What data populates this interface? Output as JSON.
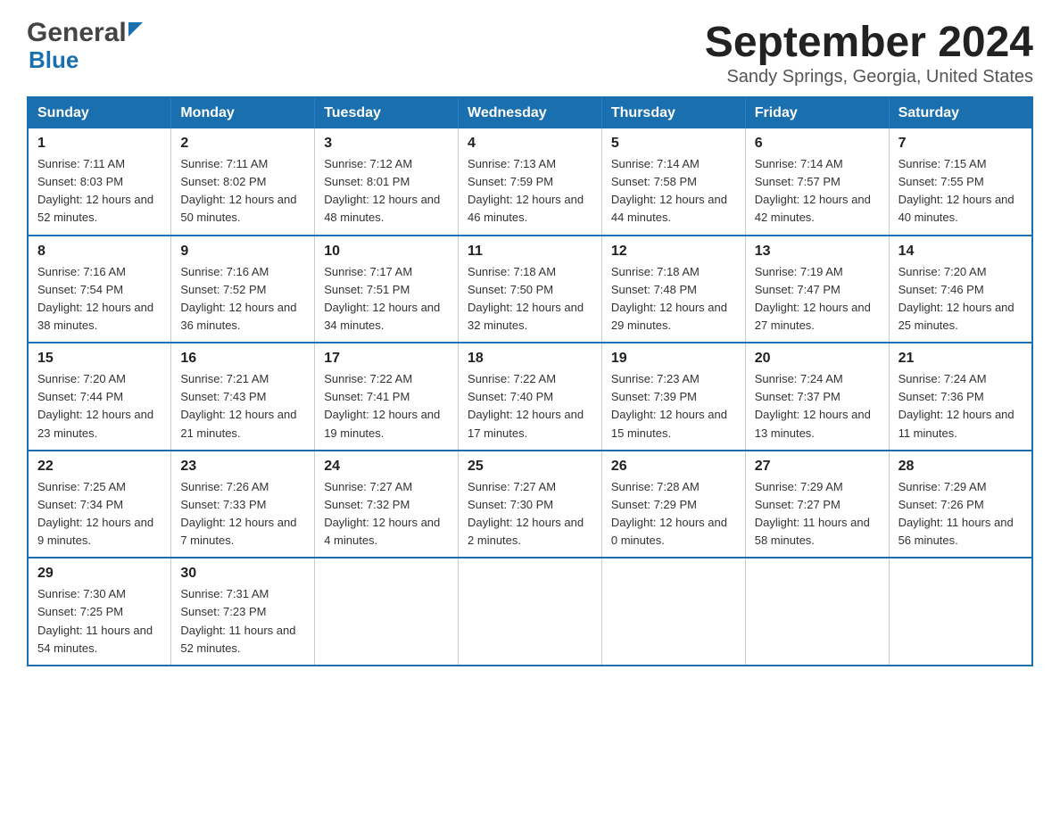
{
  "header": {
    "month_year": "September 2024",
    "location": "Sandy Springs, Georgia, United States",
    "logo_general": "General",
    "logo_blue": "Blue"
  },
  "days_of_week": [
    "Sunday",
    "Monday",
    "Tuesday",
    "Wednesday",
    "Thursday",
    "Friday",
    "Saturday"
  ],
  "weeks": [
    [
      {
        "day": "1",
        "sunrise": "Sunrise: 7:11 AM",
        "sunset": "Sunset: 8:03 PM",
        "daylight": "Daylight: 12 hours and 52 minutes."
      },
      {
        "day": "2",
        "sunrise": "Sunrise: 7:11 AM",
        "sunset": "Sunset: 8:02 PM",
        "daylight": "Daylight: 12 hours and 50 minutes."
      },
      {
        "day": "3",
        "sunrise": "Sunrise: 7:12 AM",
        "sunset": "Sunset: 8:01 PM",
        "daylight": "Daylight: 12 hours and 48 minutes."
      },
      {
        "day": "4",
        "sunrise": "Sunrise: 7:13 AM",
        "sunset": "Sunset: 7:59 PM",
        "daylight": "Daylight: 12 hours and 46 minutes."
      },
      {
        "day": "5",
        "sunrise": "Sunrise: 7:14 AM",
        "sunset": "Sunset: 7:58 PM",
        "daylight": "Daylight: 12 hours and 44 minutes."
      },
      {
        "day": "6",
        "sunrise": "Sunrise: 7:14 AM",
        "sunset": "Sunset: 7:57 PM",
        "daylight": "Daylight: 12 hours and 42 minutes."
      },
      {
        "day": "7",
        "sunrise": "Sunrise: 7:15 AM",
        "sunset": "Sunset: 7:55 PM",
        "daylight": "Daylight: 12 hours and 40 minutes."
      }
    ],
    [
      {
        "day": "8",
        "sunrise": "Sunrise: 7:16 AM",
        "sunset": "Sunset: 7:54 PM",
        "daylight": "Daylight: 12 hours and 38 minutes."
      },
      {
        "day": "9",
        "sunrise": "Sunrise: 7:16 AM",
        "sunset": "Sunset: 7:52 PM",
        "daylight": "Daylight: 12 hours and 36 minutes."
      },
      {
        "day": "10",
        "sunrise": "Sunrise: 7:17 AM",
        "sunset": "Sunset: 7:51 PM",
        "daylight": "Daylight: 12 hours and 34 minutes."
      },
      {
        "day": "11",
        "sunrise": "Sunrise: 7:18 AM",
        "sunset": "Sunset: 7:50 PM",
        "daylight": "Daylight: 12 hours and 32 minutes."
      },
      {
        "day": "12",
        "sunrise": "Sunrise: 7:18 AM",
        "sunset": "Sunset: 7:48 PM",
        "daylight": "Daylight: 12 hours and 29 minutes."
      },
      {
        "day": "13",
        "sunrise": "Sunrise: 7:19 AM",
        "sunset": "Sunset: 7:47 PM",
        "daylight": "Daylight: 12 hours and 27 minutes."
      },
      {
        "day": "14",
        "sunrise": "Sunrise: 7:20 AM",
        "sunset": "Sunset: 7:46 PM",
        "daylight": "Daylight: 12 hours and 25 minutes."
      }
    ],
    [
      {
        "day": "15",
        "sunrise": "Sunrise: 7:20 AM",
        "sunset": "Sunset: 7:44 PM",
        "daylight": "Daylight: 12 hours and 23 minutes."
      },
      {
        "day": "16",
        "sunrise": "Sunrise: 7:21 AM",
        "sunset": "Sunset: 7:43 PM",
        "daylight": "Daylight: 12 hours and 21 minutes."
      },
      {
        "day": "17",
        "sunrise": "Sunrise: 7:22 AM",
        "sunset": "Sunset: 7:41 PM",
        "daylight": "Daylight: 12 hours and 19 minutes."
      },
      {
        "day": "18",
        "sunrise": "Sunrise: 7:22 AM",
        "sunset": "Sunset: 7:40 PM",
        "daylight": "Daylight: 12 hours and 17 minutes."
      },
      {
        "day": "19",
        "sunrise": "Sunrise: 7:23 AM",
        "sunset": "Sunset: 7:39 PM",
        "daylight": "Daylight: 12 hours and 15 minutes."
      },
      {
        "day": "20",
        "sunrise": "Sunrise: 7:24 AM",
        "sunset": "Sunset: 7:37 PM",
        "daylight": "Daylight: 12 hours and 13 minutes."
      },
      {
        "day": "21",
        "sunrise": "Sunrise: 7:24 AM",
        "sunset": "Sunset: 7:36 PM",
        "daylight": "Daylight: 12 hours and 11 minutes."
      }
    ],
    [
      {
        "day": "22",
        "sunrise": "Sunrise: 7:25 AM",
        "sunset": "Sunset: 7:34 PM",
        "daylight": "Daylight: 12 hours and 9 minutes."
      },
      {
        "day": "23",
        "sunrise": "Sunrise: 7:26 AM",
        "sunset": "Sunset: 7:33 PM",
        "daylight": "Daylight: 12 hours and 7 minutes."
      },
      {
        "day": "24",
        "sunrise": "Sunrise: 7:27 AM",
        "sunset": "Sunset: 7:32 PM",
        "daylight": "Daylight: 12 hours and 4 minutes."
      },
      {
        "day": "25",
        "sunrise": "Sunrise: 7:27 AM",
        "sunset": "Sunset: 7:30 PM",
        "daylight": "Daylight: 12 hours and 2 minutes."
      },
      {
        "day": "26",
        "sunrise": "Sunrise: 7:28 AM",
        "sunset": "Sunset: 7:29 PM",
        "daylight": "Daylight: 12 hours and 0 minutes."
      },
      {
        "day": "27",
        "sunrise": "Sunrise: 7:29 AM",
        "sunset": "Sunset: 7:27 PM",
        "daylight": "Daylight: 11 hours and 58 minutes."
      },
      {
        "day": "28",
        "sunrise": "Sunrise: 7:29 AM",
        "sunset": "Sunset: 7:26 PM",
        "daylight": "Daylight: 11 hours and 56 minutes."
      }
    ],
    [
      {
        "day": "29",
        "sunrise": "Sunrise: 7:30 AM",
        "sunset": "Sunset: 7:25 PM",
        "daylight": "Daylight: 11 hours and 54 minutes."
      },
      {
        "day": "30",
        "sunrise": "Sunrise: 7:31 AM",
        "sunset": "Sunset: 7:23 PM",
        "daylight": "Daylight: 11 hours and 52 minutes."
      },
      null,
      null,
      null,
      null,
      null
    ]
  ]
}
